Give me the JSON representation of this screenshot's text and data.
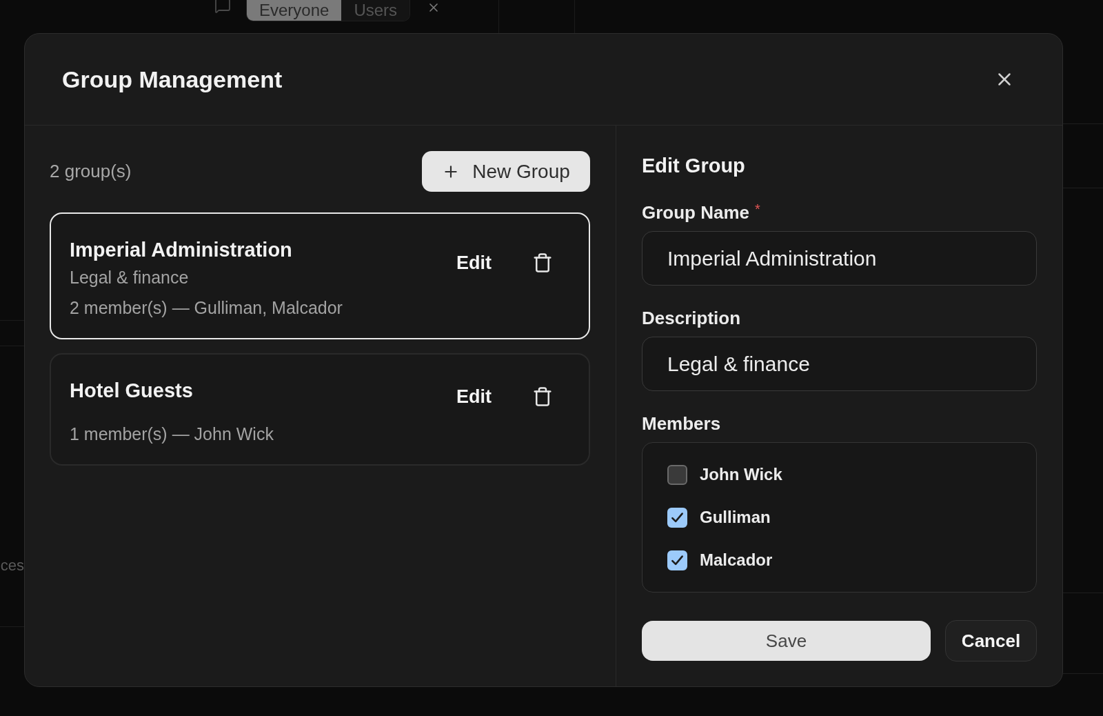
{
  "background": {
    "tabs": [
      {
        "label": "Everyone",
        "selected": true
      },
      {
        "label": "Users",
        "selected": false
      }
    ],
    "side_text": "ces"
  },
  "dialog": {
    "title": "Group Management"
  },
  "group_list": {
    "count": "2 group(s)",
    "new_button": "New Group",
    "groups": [
      {
        "name": "Imperial Administration",
        "description": "Legal & finance",
        "members": "2 member(s) — Gulliman, Malcador",
        "edit": "Edit",
        "selected": true
      },
      {
        "name": "Hotel Guests",
        "members": "1 member(s) — John Wick",
        "edit": "Edit",
        "selected": false
      }
    ]
  },
  "editor": {
    "title": "Edit Group",
    "fields": [
      {
        "label": "Group Name",
        "required_mark": "*",
        "value": "Imperial Administration"
      },
      {
        "label": "Description",
        "value": "Legal & finance"
      }
    ],
    "members_label": "Members",
    "members": [
      {
        "name": "John Wick",
        "checked": false
      },
      {
        "name": "Gulliman",
        "checked": true
      },
      {
        "name": "Malcador",
        "checked": true
      }
    ],
    "buttons": [
      {
        "label": "Save",
        "kind": "primary"
      },
      {
        "label": "Cancel",
        "kind": "secondary"
      }
    ]
  }
}
